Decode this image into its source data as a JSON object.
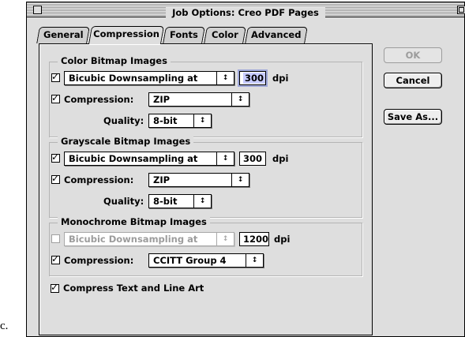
{
  "caption": "c.",
  "window": {
    "title": "Job Options: Creo PDF Pages"
  },
  "tabs": [
    {
      "label": "General",
      "active": false
    },
    {
      "label": "Compression",
      "active": true
    },
    {
      "label": "Fonts",
      "active": false
    },
    {
      "label": "Color",
      "active": false
    },
    {
      "label": "Advanced",
      "active": false
    }
  ],
  "buttons": {
    "ok": "OK",
    "cancel": "Cancel",
    "save_as": "Save As..."
  },
  "color_bitmap": {
    "title": "Color Bitmap Images",
    "downsample_checked": true,
    "downsample_method": "Bicubic Downsampling at",
    "resolution": "300",
    "resolution_unit": "dpi",
    "compression_checked": true,
    "compression_label": "Compression:",
    "compression_value": "ZIP",
    "quality_label": "Quality:",
    "quality_value": "8-bit"
  },
  "grayscale_bitmap": {
    "title": "Grayscale Bitmap Images",
    "downsample_checked": true,
    "downsample_method": "Bicubic Downsampling at",
    "resolution": "300",
    "resolution_unit": "dpi",
    "compression_checked": true,
    "compression_label": "Compression:",
    "compression_value": "ZIP",
    "quality_label": "Quality:",
    "quality_value": "8-bit"
  },
  "monochrome_bitmap": {
    "title": "Monochrome Bitmap Images",
    "downsample_checked": false,
    "downsample_method": "Bicubic Downsampling at",
    "resolution": "1200",
    "resolution_unit": "dpi",
    "compression_checked": true,
    "compression_label": "Compression:",
    "compression_value": "CCITT Group 4"
  },
  "compress_text": {
    "checked": true,
    "label": "Compress Text and Line Art"
  },
  "icons": {
    "popup_arrows": "↕",
    "checkmark": "✓"
  },
  "colors": {
    "window_bg": "#dedede",
    "field_highlight": "#c8ccff"
  }
}
